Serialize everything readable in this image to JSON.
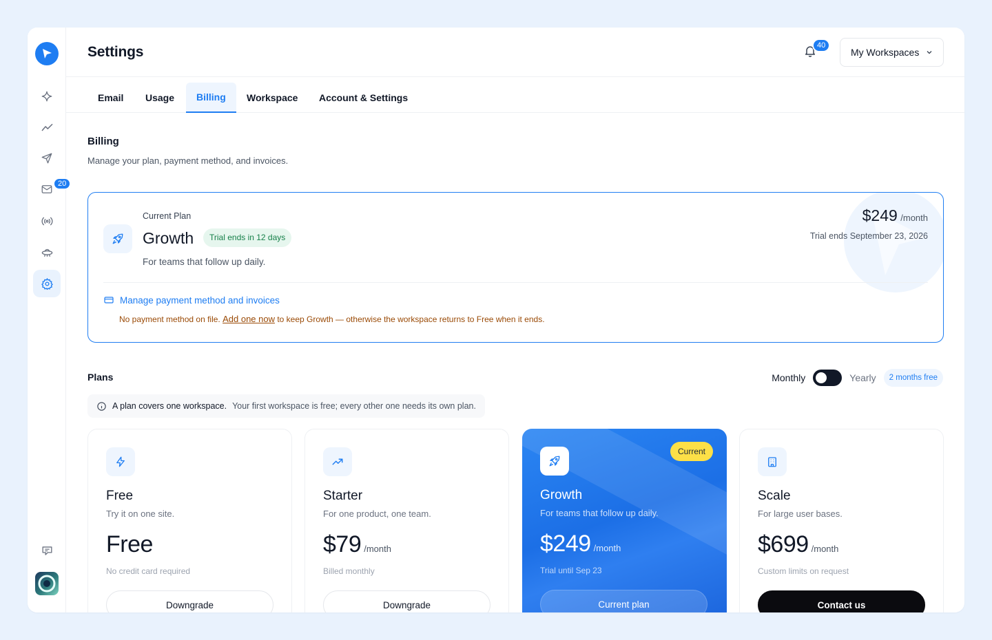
{
  "header": {
    "title": "Settings",
    "notifications_count": "40",
    "workspace_label": "My Workspaces"
  },
  "sidebar": {
    "items": [
      {
        "name": "sparkle",
        "icon": "sparkle-icon"
      },
      {
        "name": "analytics",
        "icon": "trend-icon"
      },
      {
        "name": "send",
        "icon": "paper-plane-icon"
      },
      {
        "name": "inbox",
        "icon": "mail-icon",
        "badge": "20"
      },
      {
        "name": "broadcast",
        "icon": "broadcast-icon"
      },
      {
        "name": "integrations",
        "icon": "ufo-icon"
      },
      {
        "name": "settings",
        "icon": "gear-icon",
        "active": true
      }
    ],
    "bottom": [
      {
        "name": "feedback",
        "icon": "chat-edit-icon"
      }
    ]
  },
  "tabs": [
    {
      "label": "Email"
    },
    {
      "label": "Usage"
    },
    {
      "label": "Billing",
      "active": true
    },
    {
      "label": "Workspace"
    },
    {
      "label": "Account & Settings"
    }
  ],
  "billing": {
    "title": "Billing",
    "subtitle": "Manage your plan, payment method, and invoices.",
    "current_plan": {
      "label": "Current Plan",
      "name": "Growth",
      "trial_badge": "Trial ends in 12 days",
      "description": "For teams that follow up daily.",
      "price": "$249",
      "period": "/month",
      "trial_ends": "Trial ends September 23, 2026",
      "manage_link": "Manage payment method and invoices",
      "warning_before": "No payment method on file.",
      "warning_link": "Add one now",
      "warning_after": "to keep Growth — otherwise the workspace returns to Free when it ends."
    }
  },
  "plans": {
    "title": "Plans",
    "toggle": {
      "left": "Monthly",
      "right": "Yearly",
      "promo": "2 months free"
    },
    "note_bold": "A plan covers one workspace.",
    "note_rest": "Your first workspace is free; every other one needs its own plan.",
    "cards": [
      {
        "name": "Free",
        "desc": "Try it on one site.",
        "price": "Free",
        "period": "",
        "meta": "No credit card required",
        "button": "Downgrade",
        "icon": "bolt-icon"
      },
      {
        "name": "Starter",
        "desc": "For one product, one team.",
        "price": "$79",
        "period": "/month",
        "meta": "Billed monthly",
        "button": "Downgrade",
        "icon": "trend-up-icon"
      },
      {
        "name": "Growth",
        "desc": "For teams that follow up daily.",
        "price": "$249",
        "period": "/month",
        "meta": "Trial until Sep 23",
        "button": "Current plan",
        "badge": "Current",
        "icon": "rocket-icon"
      },
      {
        "name": "Scale",
        "desc": "For large user bases.",
        "price": "$699",
        "period": "/month",
        "meta": "Custom limits on request",
        "button": "Contact us",
        "icon": "building-icon"
      }
    ]
  },
  "colors": {
    "accent": "#1e7df2",
    "badge_yellow": "#fde047",
    "success_bg": "#e6f6ee",
    "warning_text": "#9a4a06"
  }
}
